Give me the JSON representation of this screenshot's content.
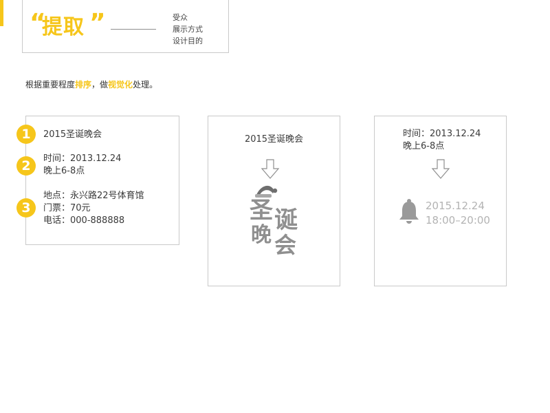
{
  "header": {
    "title": "提取",
    "quote_open": "“",
    "quote_close": "”",
    "items": [
      "受众",
      "展示方式",
      "设计目的"
    ]
  },
  "intro": {
    "before": "根据重要程度",
    "highlight1": "排序",
    "middle": "，做",
    "highlight2": "视觉化",
    "after": "处理。"
  },
  "card1": {
    "badges": [
      "1",
      "2",
      "3"
    ],
    "event": "2015圣诞晚会",
    "time": "时间：2013.12.24",
    "time_range": "晚上6-8点",
    "location": "地点：永兴路22号体育馆",
    "ticket": "门票：70元",
    "phone": "电话：000-888888"
  },
  "card2": {
    "event": "2015圣诞晚会",
    "logo_text": [
      "圣",
      "诞",
      "晚",
      "会"
    ]
  },
  "card3": {
    "time": "时间：2013.12.24",
    "time_range": "晚上6-8点",
    "date": "2015.12.24",
    "hours": "18:00–20:00"
  },
  "colors": {
    "accent": "#f6c61b",
    "border": "#c9c9c9",
    "muted": "#b3b3b3"
  }
}
